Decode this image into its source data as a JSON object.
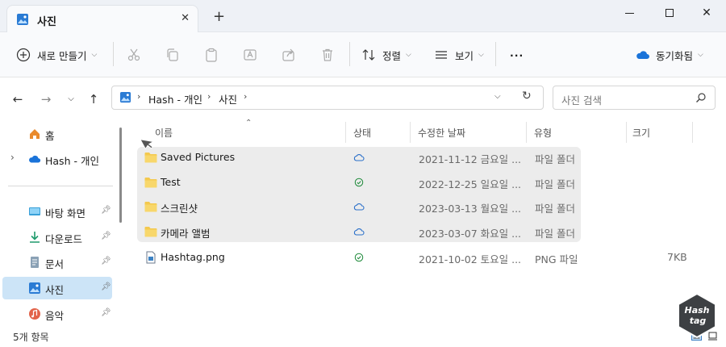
{
  "window": {
    "tab_title": "사진",
    "tab_close": "✕",
    "new_tab": "+"
  },
  "toolbar": {
    "new_label": "새로 만들기",
    "sort_label": "정렬",
    "view_label": "보기",
    "more_label": "···",
    "onedrive_label": "동기화됨"
  },
  "address": {
    "crumbs": [
      "Hash - 개인",
      "사진"
    ],
    "search_placeholder": "사진 검색"
  },
  "sidebar": {
    "items": [
      {
        "label": "홈"
      },
      {
        "label": "Hash - 개인"
      },
      {
        "label": "바탕 화면"
      },
      {
        "label": "다운로드"
      },
      {
        "label": "문서"
      },
      {
        "label": "사진"
      },
      {
        "label": "음악"
      }
    ]
  },
  "columns": {
    "name": "이름",
    "status": "상태",
    "modified": "수정한 날짜",
    "type": "유형",
    "size": "크기"
  },
  "rows": [
    {
      "name": "Saved Pictures",
      "date": "2021-11-12 금요일 ...",
      "type": "파일 폴더",
      "size": "",
      "status": "cloud"
    },
    {
      "name": "Test",
      "date": "2022-12-25 일요일 ...",
      "type": "파일 폴더",
      "size": "",
      "status": "synced"
    },
    {
      "name": "스크린샷",
      "date": "2023-03-13 월요일 ...",
      "type": "파일 폴더",
      "size": "",
      "status": "cloud"
    },
    {
      "name": "카메라 앨범",
      "date": "2023-03-07 화요일 ...",
      "type": "파일 폴더",
      "size": "",
      "status": "cloud"
    },
    {
      "name": "Hashtag.png",
      "date": "2021-10-02 토요일 ...",
      "type": "PNG 파일",
      "size": "7KB",
      "status": "synced"
    }
  ],
  "statusbar": {
    "item_count": "5개 항목"
  },
  "watermark": {
    "line1": "Hash",
    "line2": "tag"
  },
  "colors": {
    "accent": "#0f6cbd",
    "selected_nav": "#cce4f7",
    "selection_group": "#ececec",
    "folder": "#f4c94e",
    "synced_green": "#1e8a3a",
    "cloud_blue": "#2a6fc9"
  }
}
